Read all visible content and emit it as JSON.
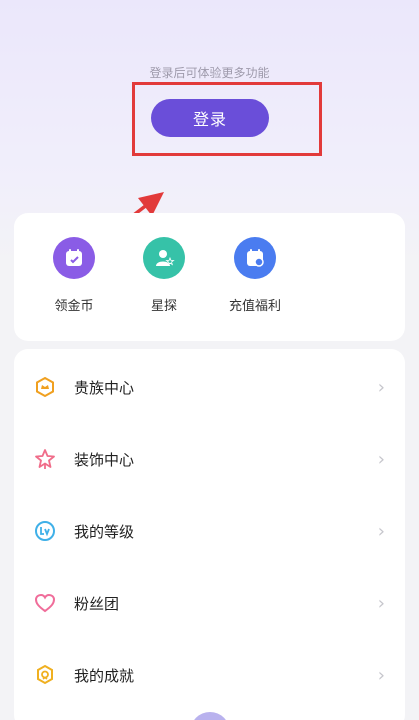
{
  "login": {
    "hint": "登录后可体验更多功能",
    "button_label": "登录"
  },
  "quick_actions": [
    {
      "label": "领金币",
      "icon": "coin-calendar-icon",
      "color": "#8a5ce6"
    },
    {
      "label": "星探",
      "icon": "user-star-icon",
      "color": "#36c2a8"
    },
    {
      "label": "充值福利",
      "icon": "recharge-calendar-icon",
      "color": "#4a7cf0"
    }
  ],
  "menu": [
    {
      "label": "贵族中心",
      "icon": "noble-hexagon-icon",
      "color": "#f0a020"
    },
    {
      "label": "装饰中心",
      "icon": "decoration-star-icon",
      "color": "#f06d8a"
    },
    {
      "label": "我的等级",
      "icon": "level-lv-icon",
      "color": "#3fb0e8"
    },
    {
      "label": "粉丝团",
      "icon": "heart-icon",
      "color": "#f06d9a"
    },
    {
      "label": "我的成就",
      "icon": "achievement-badge-icon",
      "color": "#f0b020"
    }
  ],
  "accent_color": "#6a4ed9",
  "highlight_color": "#e23a3a"
}
